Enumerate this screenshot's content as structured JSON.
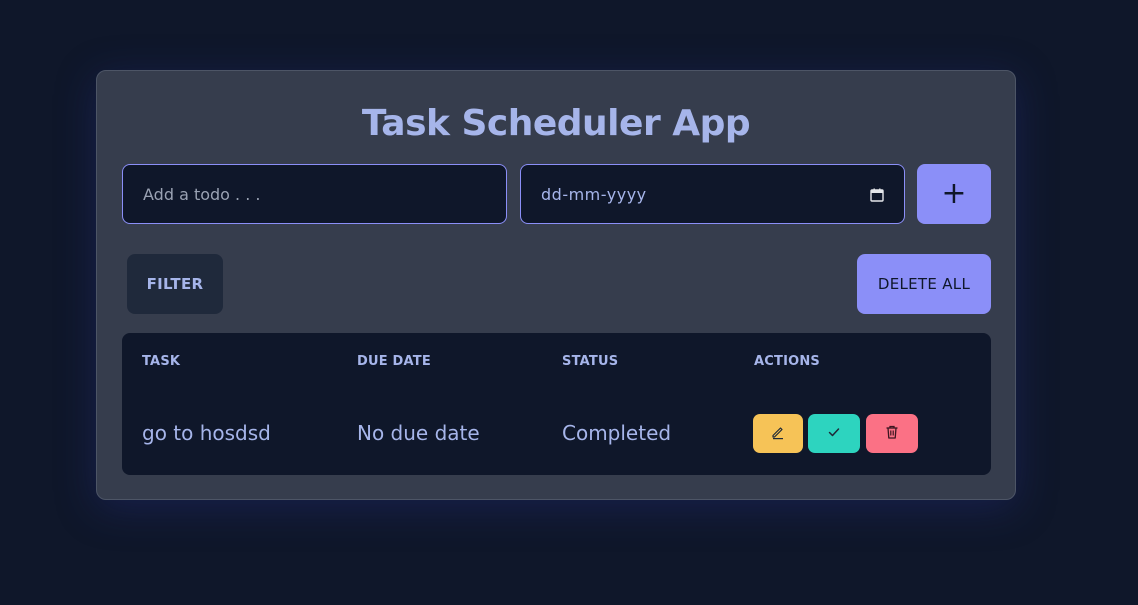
{
  "app": {
    "title": "Task Scheduler App"
  },
  "form": {
    "todo_placeholder": "Add a todo . . .",
    "date_placeholder": "dd-mm-yyyy",
    "add_label": "+"
  },
  "toolbar": {
    "filter_label": "FILTER",
    "delete_all_label": "DELETE ALL"
  },
  "table": {
    "headers": [
      "TASK",
      "DUE DATE",
      "STATUS",
      "ACTIONS"
    ],
    "rows": [
      {
        "task": "go to hosdsd",
        "due_date": "No due date",
        "status": "Completed"
      }
    ]
  },
  "icons": {
    "add": "plus-icon",
    "calendar": "calendar-icon",
    "edit": "pencil-icon",
    "complete": "check-icon",
    "delete": "trash-icon"
  },
  "colors": {
    "background": "#0f172a",
    "card": "#363d4d",
    "accent": "#8b8ff8",
    "text": "#a6b5ea",
    "edit": "#f6c357",
    "complete": "#2dd4bf",
    "delete": "#fb7185"
  }
}
